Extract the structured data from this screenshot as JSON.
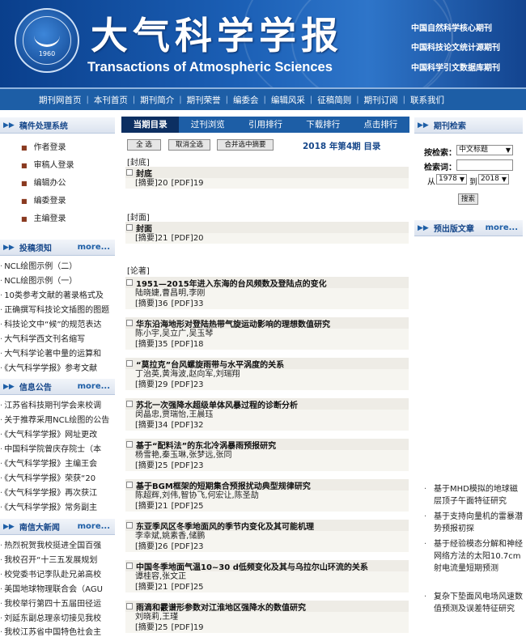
{
  "header": {
    "logo_year": "1960",
    "title_cn": "大气科学学报",
    "title_en": "Transactions of Atmospheric Sciences",
    "tags": [
      "中国自然科学核心期刊",
      "中国科技论文统计源期刊",
      "中国科学引文数据库期刊"
    ]
  },
  "nav": [
    "期刊网首页",
    "本刊首页",
    "期刊简介",
    "期刊荣誉",
    "编委会",
    "编辑风采",
    "征稿简则",
    "期刊订阅",
    "联系我们"
  ],
  "left": {
    "system_title": "稿件处理系统",
    "system_items": [
      "作者登录",
      "审稿人登录",
      "编辑办公",
      "编委登录",
      "主编登录"
    ],
    "notice_title": "投稿须知",
    "notice_more": "more...",
    "notice_items": [
      "NCL绘图示例（二）",
      "NCL绘图示例（一）",
      "10类参考文献的著录格式及",
      "正确撰写科技论文插图的图题",
      "科技论文中“候”的规范表达",
      "大气科学西文刊名缩写",
      "大气科学论著中量的运算和",
      "《大气科学学报》参考文献"
    ],
    "news_title": "信息公告",
    "news_more": "more...",
    "news_items": [
      "江苏省科技期刊学会来校调",
      "关于推荐采用NCL绘图的公告",
      "《大气科学学报》网址更改",
      "中国科学院曾庆存院士（本",
      "《大气科学学报》主编王会",
      "《大气科学学报》荣获“20",
      "《大气科学学报》再次获江",
      "《大气科学学报》常务副主"
    ],
    "campus_title": "南信大新闻",
    "campus_more": "more...",
    "campus_items": [
      "热烈祝贺我校挺进全国百强",
      "我校召开“十三五发展规划",
      "校党委书记李队赴兄弟高校",
      "美国地球物理联合会（AGU",
      "我校举行第四十五届田径运",
      "刘延东副总理亲切接见我校",
      "我校江苏省中国特色社会主"
    ]
  },
  "center": {
    "tabs": [
      "当期目录",
      "过刊浏览",
      "引用排行",
      "下载排行",
      "点击排行"
    ],
    "btn_select_all": "全 选",
    "btn_deselect_all": "取消全选",
    "btn_merge": "合并选中摘要",
    "issue_label": "2018 年第4期 目录",
    "sections": {
      "fengdi": "[封底]",
      "fengmian": "[封面]",
      "lunzhu": "[论著]"
    },
    "articles": [
      {
        "title": "封底",
        "authors": "",
        "abstract": "[摘要]20",
        "pdf": "[PDF]19"
      },
      {
        "title": "封面",
        "authors": "",
        "abstract": "[摘要]21",
        "pdf": "[PDF]20"
      },
      {
        "title": "1951—2015年进入东海的台风频数及登陆点的变化",
        "authors": "陆晓婕,曹昌明,李刚",
        "abstract": "[摘要]36",
        "pdf": "[PDF]33"
      },
      {
        "title": "华东沿海地形对登陆热带气旋运动影响的理想数值研究",
        "authors": "陈小宇,吴立广,吴玉琴",
        "abstract": "[摘要]35",
        "pdf": "[PDF]18"
      },
      {
        "title": "“莫拉克”台风螺旋雨带与水平涡度的关系",
        "authors": "丁治英,黄海波,赵向军,刘瑞翔",
        "abstract": "[摘要]29",
        "pdf": "[PDF]23"
      },
      {
        "title": "苏北一次强降水超级单体风暴过程的诊断分析",
        "authors": "闵晶忠,贾瑞怡,王晨珏",
        "abstract": "[摘要]34",
        "pdf": "[PDF]32"
      },
      {
        "title": "基于“配料法”的东北冷涡暴雨预报研究",
        "authors": "杨雪艳,秦玉琳,张梦远,张同",
        "abstract": "[摘要]25",
        "pdf": "[PDF]23"
      },
      {
        "title": "基于BGM框架的短期集合预报扰动典型规律研究",
        "authors": "陈超辉,刘伟,智协飞,何宏让,陈圣劼",
        "abstract": "[摘要]21",
        "pdf": "[PDF]25"
      },
      {
        "title": "东亚季风区冬季地面风的季节内变化及其可能机理",
        "authors": "李幸斌,姚素香,储鹏",
        "abstract": "[摘要]26",
        "pdf": "[PDF]23"
      },
      {
        "title": "中国冬季地面气温10~30 d低频变化及其与乌拉尔山环流的关系",
        "authors": "谭桂容,张文正",
        "abstract": "[摘要]21",
        "pdf": "[PDF]25"
      },
      {
        "title": "雨滴和霰谱形参数对江淮地区强降水的数值研究",
        "authors": "刘晓莉,王瑾",
        "abstract": "[摘要]25",
        "pdf": "[PDF]19"
      }
    ]
  },
  "right": {
    "search_title": "期刊检索",
    "by_label": "按检索：",
    "by_value": "中文标题",
    "keyword_label": "检索词：",
    "keyword_value": "",
    "from_label": "从",
    "year_from": "1978",
    "to_label": "到",
    "year_to": "2018",
    "search_btn": "搜索",
    "preprint_title": "预出版文章",
    "preprint_more": "more...",
    "preprint_items": [
      "基于MHD模拟的地球磁层顶子午面特征研究",
      "基于支持向量机的雷暴潜势预报初探",
      "基于经验模态分解和神经网络方法的太阳10.7cm射电流量短期预测",
      "复杂下垫面风电场风速数值预测及误差特征研究"
    ]
  }
}
